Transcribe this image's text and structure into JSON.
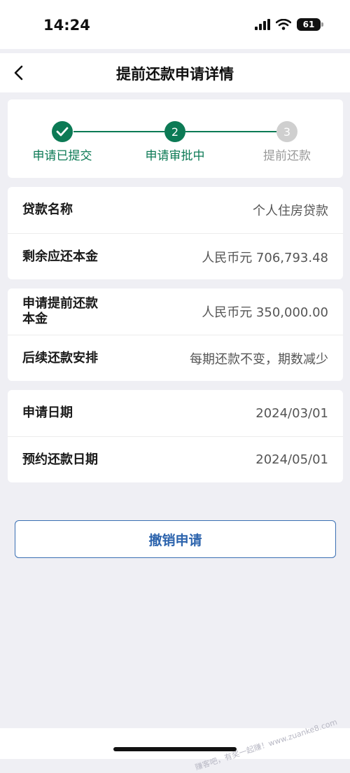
{
  "status": {
    "time": "14:24",
    "battery": "61"
  },
  "nav": {
    "title": "提前还款申请详情"
  },
  "stepper": {
    "steps": [
      {
        "label": "申请已提交",
        "marker": "",
        "state": "done"
      },
      {
        "label": "申请审批中",
        "marker": "2",
        "state": "active"
      },
      {
        "label": "提前还款",
        "marker": "3",
        "state": "pending"
      }
    ]
  },
  "group1": {
    "rows": [
      {
        "label": "贷款名称",
        "value": "个人住房贷款"
      },
      {
        "label": "剩余应还本金",
        "value": "人民币元 706,793.48"
      }
    ]
  },
  "group2": {
    "rows": [
      {
        "label": "申请提前还款本金",
        "value": "人民币元 350,000.00"
      },
      {
        "label": "后续还款安排",
        "value": "每期还款不变，期数减少"
      }
    ]
  },
  "group3": {
    "rows": [
      {
        "label": "申请日期",
        "value": "2024/03/01"
      },
      {
        "label": "预约还款日期",
        "value": "2024/05/01"
      }
    ]
  },
  "actions": {
    "cancel_label": "撤销申请"
  },
  "watermark": "赚客吧，有奖一起赚！www.zuanke8.com",
  "colors": {
    "primary_green": "#0c7a55",
    "pending_gray": "#cfcfcf",
    "link_blue": "#2d64ad",
    "background": "#efeff4"
  }
}
